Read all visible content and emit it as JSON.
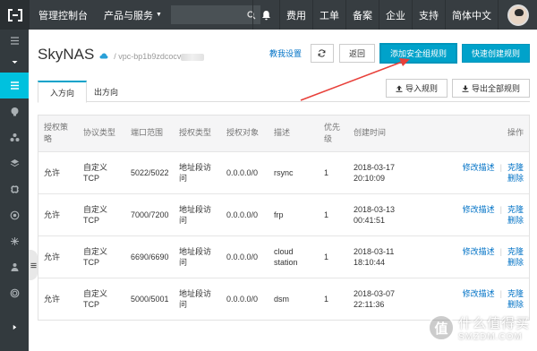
{
  "topbar": {
    "console_title": "管理控制台",
    "products_label": "产品与服务",
    "menu": [
      "费用",
      "工单",
      "备案",
      "企业",
      "支持",
      "简体中文"
    ]
  },
  "page": {
    "title": "SkyNAS",
    "vpc_prefix": "/ vpc-bp1b9zdcocv",
    "help_link": "教我设置",
    "back_label": "返回",
    "add_rule_label": "添加安全组规则",
    "quick_rule_label": "快速创建规则"
  },
  "tabs": {
    "inbound": "入方向",
    "outbound": "出方向",
    "import_label": "导入规则",
    "export_label": "导出全部规则"
  },
  "table": {
    "headers": {
      "policy": "授权策略",
      "protocol": "协议类型",
      "port": "端口范围",
      "auth_type": "授权类型",
      "auth_obj": "授权对象",
      "desc": "描述",
      "priority": "优先级",
      "created": "创建时间",
      "ops": "操作"
    },
    "ops_labels": {
      "edit": "修改描述",
      "clone": "克隆",
      "delete": "删除"
    },
    "rows": [
      {
        "policy": "允许",
        "protocol": "自定义 TCP",
        "port": "5022/5022",
        "auth_type": "地址段访问",
        "auth_obj": "0.0.0.0/0",
        "desc": "rsync",
        "priority": "1",
        "created": "2018-03-17 20:10:09"
      },
      {
        "policy": "允许",
        "protocol": "自定义 TCP",
        "port": "7000/7200",
        "auth_type": "地址段访问",
        "auth_obj": "0.0.0.0/0",
        "desc": "frp",
        "priority": "1",
        "created": "2018-03-13 00:41:51"
      },
      {
        "policy": "允许",
        "protocol": "自定义 TCP",
        "port": "6690/6690",
        "auth_type": "地址段访问",
        "auth_obj": "0.0.0.0/0",
        "desc": "cloud station",
        "priority": "1",
        "created": "2018-03-11 18:10:44"
      },
      {
        "policy": "允许",
        "protocol": "自定义 TCP",
        "port": "5000/5001",
        "auth_type": "地址段访问",
        "auth_obj": "0.0.0.0/0",
        "desc": "dsm",
        "priority": "1",
        "created": "2018-03-07 22:11:36"
      }
    ]
  },
  "watermark": {
    "glyph": "值",
    "main": "什么值得买",
    "sub": "SMZDM.COM"
  },
  "colors": {
    "topbar": "#373d41",
    "sidebar": "#333a3e",
    "accent": "#00c1de",
    "primary_button": "#00a2ca",
    "link": "#0072c6",
    "annotation_arrow": "#e8403a"
  }
}
